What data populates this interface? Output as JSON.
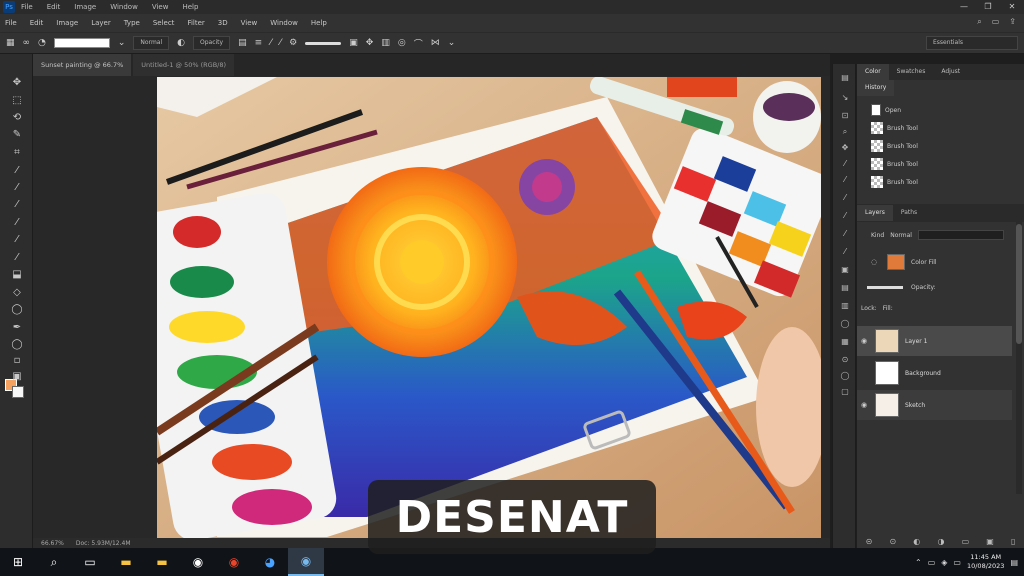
{
  "titlebar": {
    "menus": [
      "File",
      "Edit",
      "Image",
      "Window",
      "View",
      "Help"
    ],
    "window_controls": [
      "—",
      "❐",
      "✕"
    ]
  },
  "menubar": {
    "items": [
      "File",
      "Edit",
      "Image",
      "Layer",
      "Type",
      "Select",
      "Filter",
      "3D",
      "View",
      "Window",
      "Help"
    ]
  },
  "optbar": {
    "mode_label": "Normal",
    "opacity_label": "Opacity",
    "workspace": "Essentials"
  },
  "doctabs": [
    {
      "label": "Sunset painting @ 66.7%"
    },
    {
      "label": "Untitled-1 @ 50% (RGB/8)"
    }
  ],
  "statusbar": {
    "zoom": "66.67%",
    "doc_info": "Doc: 5.93M/12.4M"
  },
  "panels": {
    "top_tabs": [
      "Color",
      "Swatches",
      "Adjust"
    ],
    "history_tab": "History",
    "history_items": [
      {
        "label": "Open"
      },
      {
        "label": "Brush Tool"
      },
      {
        "label": "Brush Tool"
      },
      {
        "label": "Brush Tool"
      },
      {
        "label": "Brush Tool"
      }
    ],
    "layers_tabs": [
      "Layers",
      "Paths"
    ],
    "kind_label": "Kind",
    "blend_mode": "Normal",
    "opacity_label": "Opacity:",
    "fill_label": "Fill:",
    "lock_label": "Lock:",
    "adjust_label": "Color Fill",
    "layers": [
      {
        "name": "Layer 1",
        "thumb": "#ecd7b8"
      },
      {
        "name": "Background",
        "thumb": "#ffffff"
      },
      {
        "name": "Sketch",
        "thumb": "#f5efe8"
      }
    ]
  },
  "taskbar": {
    "time": "11:45 AM",
    "date": "10/08/2023"
  },
  "caption": "DESENAT"
}
